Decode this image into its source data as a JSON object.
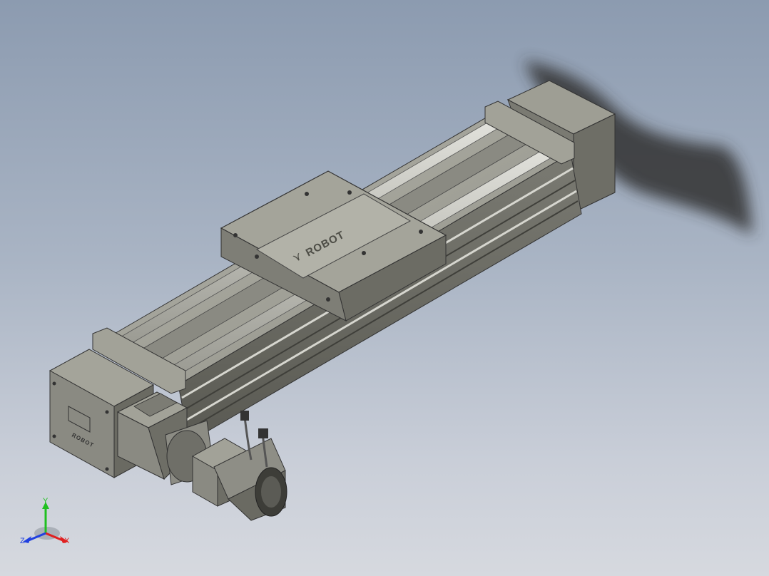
{
  "viewport": {
    "background_top": "#8c9bb0",
    "background_bottom": "#d6d9df"
  },
  "model": {
    "carriage_logo": "ROBOT",
    "end_cap_logo": "ROBOT",
    "body_color": "#8a8a80",
    "body_dark": "#5e5e56",
    "body_light": "#a8a89e",
    "rail_color": "#c9c9c2",
    "motor_color": "#7e7e76"
  },
  "triad": {
    "x_label": "X",
    "y_label": "Y",
    "z_label": "Z",
    "x_color": "#e02020",
    "y_color": "#20c020",
    "z_color": "#2040e0"
  }
}
